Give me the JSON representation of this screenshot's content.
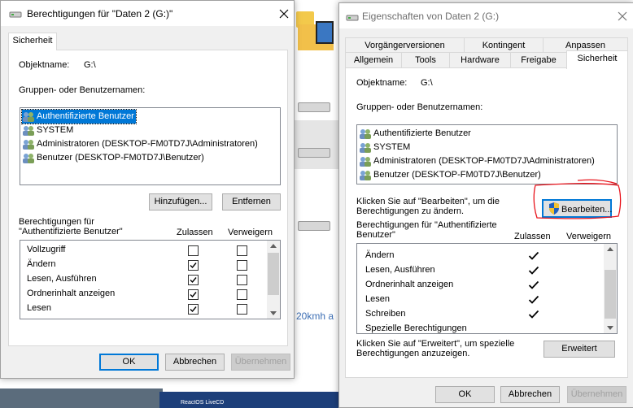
{
  "background": {
    "folder_label": "",
    "text_fragment": "20kmh a",
    "taskbar_text": "ReactOS LiveCD"
  },
  "perm_dialog": {
    "title": "Berechtigungen für \"Daten 2 (G:)\"",
    "tab": "Sicherheit",
    "object_label": "Objektname:",
    "object_value": "G:\\",
    "groups_label": "Gruppen- oder Benutzernamen:",
    "users": [
      "Authentifizierte Benutzer",
      "SYSTEM",
      "Administratoren (DESKTOP-FM0TD7J\\Administratoren)",
      "Benutzer (DESKTOP-FM0TD7J\\Benutzer)"
    ],
    "add_button": "Hinzufügen...",
    "remove_button": "Entfernen",
    "perm_label": "Berechtigungen für \"Authentifizierte Benutzer\"",
    "col_allow": "Zulassen",
    "col_deny": "Verweigern",
    "permissions": [
      {
        "name": "Vollzugriff",
        "allow": false,
        "deny": false
      },
      {
        "name": "Ändern",
        "allow": true,
        "deny": false
      },
      {
        "name": "Lesen, Ausführen",
        "allow": true,
        "deny": false
      },
      {
        "name": "Ordnerinhalt anzeigen",
        "allow": true,
        "deny": false
      },
      {
        "name": "Lesen",
        "allow": true,
        "deny": false
      }
    ],
    "ok": "OK",
    "cancel": "Abbrechen",
    "apply": "Übernehmen"
  },
  "props_dialog": {
    "title": "Eigenschaften von Daten 2 (G:)",
    "tabs_row1": [
      "Vorgängerversionen",
      "Kontingent",
      "Anpassen"
    ],
    "tabs_row2": [
      "Allgemein",
      "Tools",
      "Hardware",
      "Freigabe",
      "Sicherheit"
    ],
    "object_label": "Objektname:",
    "object_value": "G:\\",
    "groups_label": "Gruppen- oder Benutzernamen:",
    "users": [
      "Authentifizierte Benutzer",
      "SYSTEM",
      "Administratoren (DESKTOP-FM0TD7J\\Administratoren)",
      "Benutzer (DESKTOP-FM0TD7J\\Benutzer)"
    ],
    "edit_hint": "Klicken Sie auf \"Bearbeiten\", um die Berechtigungen zu ändern.",
    "edit_button": "Bearbeiten...",
    "perm_label": "Berechtigungen für \"Authentifizierte Benutzer\"",
    "col_allow": "Zulassen",
    "col_deny": "Verweigern",
    "permissions": [
      {
        "name": "Ändern",
        "allow": true
      },
      {
        "name": "Lesen, Ausführen",
        "allow": true
      },
      {
        "name": "Ordnerinhalt anzeigen",
        "allow": true
      },
      {
        "name": "Lesen",
        "allow": true
      },
      {
        "name": "Schreiben",
        "allow": true
      },
      {
        "name": "Spezielle Berechtigungen",
        "allow": false
      }
    ],
    "advanced_hint": "Klicken Sie auf \"Erweitert\", um spezielle Berechtigungen anzuzeigen.",
    "advanced_button": "Erweitert",
    "ok": "OK",
    "cancel": "Abbrechen",
    "apply": "Übernehmen"
  },
  "colors": {
    "accent": "#0078d7",
    "annotation": "#e8141c"
  }
}
